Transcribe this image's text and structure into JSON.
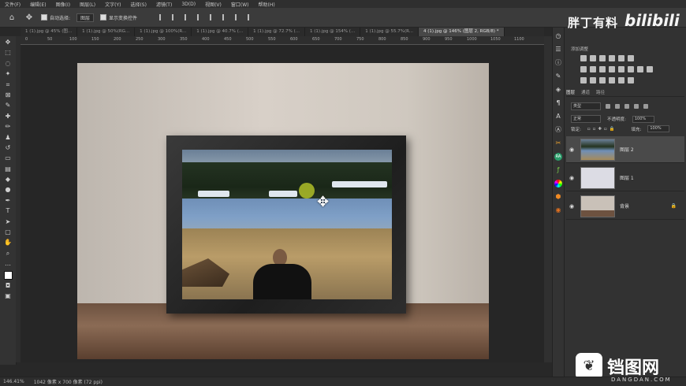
{
  "menubar": {
    "items": [
      "文件(F)",
      "编辑(E)",
      "图像(I)",
      "图层(L)",
      "文字(Y)",
      "选择(S)",
      "滤镜(T)",
      "3D(D)",
      "视图(V)",
      "窗口(W)",
      "帮助(H)"
    ]
  },
  "options": {
    "auto_select_label": "自动选择:",
    "auto_select_value": "图层",
    "transform_controls_label": "显示变换控件"
  },
  "tabs": [
    {
      "label": "1 (1).jpg @ 45% (图...",
      "active": false
    },
    {
      "label": "1 (1).jpg @ 50%(RG...",
      "active": false
    },
    {
      "label": "1 (1).jpg @ 100%(R...",
      "active": false
    },
    {
      "label": "1 (1).jpg @ 40.7% (...",
      "active": false
    },
    {
      "label": "1 (1).jpg @ 72.7% (...",
      "active": false
    },
    {
      "label": "1 (1).jpg @ 154% (...",
      "active": false
    },
    {
      "label": "1 (1).jpg @ 55.7%(R...",
      "active": false
    },
    {
      "label": "4 (1).jpg @ 146% (图层 2, RGB/8) *",
      "active": true
    }
  ],
  "ruler_ticks": [
    "0",
    "50",
    "100",
    "150",
    "200",
    "250",
    "300",
    "350",
    "400",
    "450",
    "500",
    "550",
    "600",
    "650",
    "700",
    "750",
    "800",
    "850",
    "900",
    "950",
    "1000",
    "1050",
    "1100"
  ],
  "status": {
    "zoom": "146.41%",
    "doc_size": "1042 像素 x 700 像素 (72 ppi)"
  },
  "brand": {
    "name": "胖丁有料",
    "site": "bilibili"
  },
  "adjustments": {
    "title": "添加调整"
  },
  "layers_panel": {
    "tabs": [
      "图层",
      "通道",
      "路径"
    ],
    "filter_label": "类型",
    "blend_mode": "正常",
    "opacity_label": "不透明度:",
    "opacity_value": "100%",
    "lock_label": "锁定:",
    "fill_label": "填充:",
    "fill_value": "100%",
    "layers": [
      {
        "name": "图层 2",
        "selected": true,
        "thumb_color": "#6f8fb7"
      },
      {
        "name": "图层 1",
        "selected": false,
        "thumb_color": "#dcdce4"
      },
      {
        "name": "背景",
        "selected": false,
        "thumb_color": "#bfb6ac",
        "locked": true
      }
    ]
  },
  "watermark": {
    "text": "铛图网",
    "sub": "DANGDAN.COM"
  }
}
